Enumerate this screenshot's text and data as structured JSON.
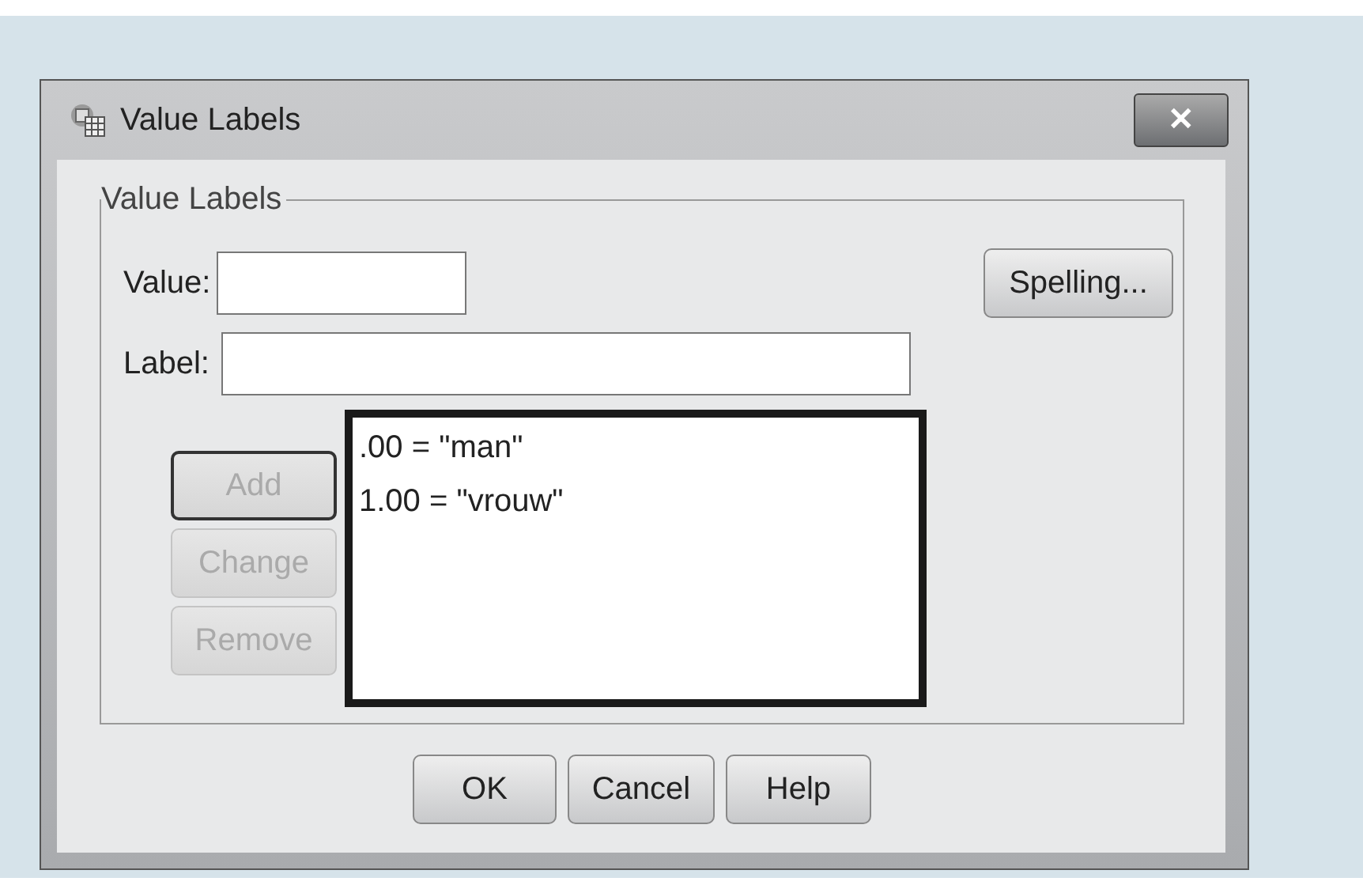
{
  "window": {
    "title": "Value Labels",
    "close": "✕"
  },
  "group": {
    "title": "Value Labels"
  },
  "value_field": {
    "label": "Value:"
  },
  "label_field": {
    "label": "Label:"
  },
  "spelling_button": {
    "label": "Spelling..."
  },
  "side_buttons": [
    {
      "label": "Add",
      "disabled": true,
      "focused": true
    },
    {
      "label": "Change",
      "disabled": true,
      "focused": false
    },
    {
      "label": "Remove",
      "disabled": true,
      "focused": false
    }
  ],
  "list": {
    "items": [
      ".00 = \"man\"",
      "1.00 = \"vrouw\""
    ]
  },
  "buttons": [
    {
      "label": "OK"
    },
    {
      "label": "Cancel"
    },
    {
      "label": "Help"
    }
  ]
}
